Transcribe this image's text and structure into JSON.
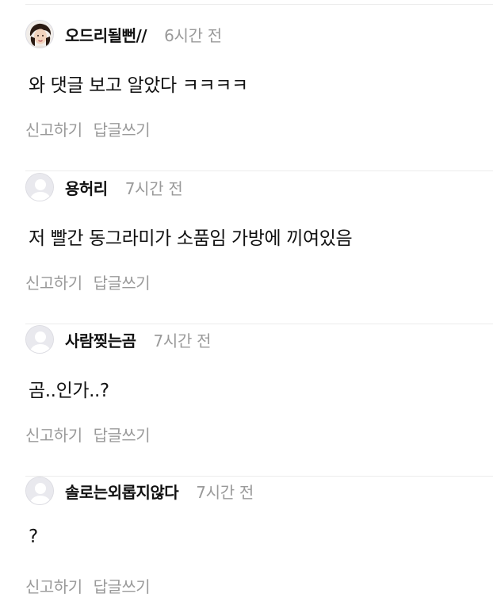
{
  "comments": [
    {
      "nickname": "오드리될뻔//",
      "time": "6시간 전",
      "text": "와 댓글 보고 알았다 ㅋㅋㅋㅋ",
      "avatar": "photo-avatar",
      "report_label": "신고하기",
      "reply_label": "답글쓰기"
    },
    {
      "nickname": "용허리",
      "time": "7시간 전",
      "text": "저 빨간 동그라미가 소품임 가방에 끼여있음",
      "avatar": "default-avatar",
      "report_label": "신고하기",
      "reply_label": "답글쓰기"
    },
    {
      "nickname": "사람찢는곰",
      "time": "7시간 전",
      "text": "곰..인가..?",
      "avatar": "default-avatar",
      "report_label": "신고하기",
      "reply_label": "답글쓰기"
    },
    {
      "nickname": "솔로는외롭지않다",
      "time": "7시간 전",
      "text": "?",
      "avatar": "default-avatar",
      "report_label": "신고하기",
      "reply_label": "답글쓰기"
    }
  ],
  "colors": {
    "text": "#111111",
    "muted": "#9a9a9a",
    "divider": "#ececec",
    "avatar_bg": "#e9e9ee"
  }
}
